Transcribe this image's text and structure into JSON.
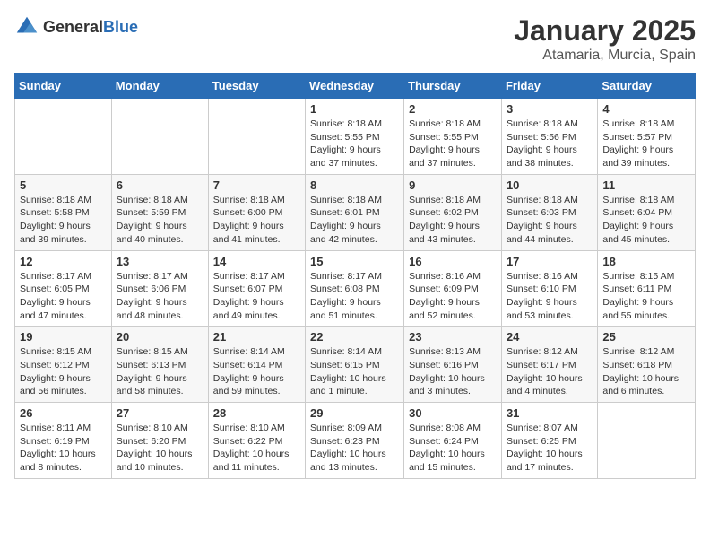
{
  "header": {
    "logo": {
      "general": "General",
      "blue": "Blue"
    },
    "title": "January 2025",
    "subtitle": "Atamaria, Murcia, Spain"
  },
  "days_of_week": [
    "Sunday",
    "Monday",
    "Tuesday",
    "Wednesday",
    "Thursday",
    "Friday",
    "Saturday"
  ],
  "weeks": [
    [
      {
        "day": "",
        "info": ""
      },
      {
        "day": "",
        "info": ""
      },
      {
        "day": "",
        "info": ""
      },
      {
        "day": "1",
        "info": "Sunrise: 8:18 AM\nSunset: 5:55 PM\nDaylight: 9 hours\nand 37 minutes."
      },
      {
        "day": "2",
        "info": "Sunrise: 8:18 AM\nSunset: 5:55 PM\nDaylight: 9 hours\nand 37 minutes."
      },
      {
        "day": "3",
        "info": "Sunrise: 8:18 AM\nSunset: 5:56 PM\nDaylight: 9 hours\nand 38 minutes."
      },
      {
        "day": "4",
        "info": "Sunrise: 8:18 AM\nSunset: 5:57 PM\nDaylight: 9 hours\nand 39 minutes."
      }
    ],
    [
      {
        "day": "5",
        "info": "Sunrise: 8:18 AM\nSunset: 5:58 PM\nDaylight: 9 hours\nand 39 minutes."
      },
      {
        "day": "6",
        "info": "Sunrise: 8:18 AM\nSunset: 5:59 PM\nDaylight: 9 hours\nand 40 minutes."
      },
      {
        "day": "7",
        "info": "Sunrise: 8:18 AM\nSunset: 6:00 PM\nDaylight: 9 hours\nand 41 minutes."
      },
      {
        "day": "8",
        "info": "Sunrise: 8:18 AM\nSunset: 6:01 PM\nDaylight: 9 hours\nand 42 minutes."
      },
      {
        "day": "9",
        "info": "Sunrise: 8:18 AM\nSunset: 6:02 PM\nDaylight: 9 hours\nand 43 minutes."
      },
      {
        "day": "10",
        "info": "Sunrise: 8:18 AM\nSunset: 6:03 PM\nDaylight: 9 hours\nand 44 minutes."
      },
      {
        "day": "11",
        "info": "Sunrise: 8:18 AM\nSunset: 6:04 PM\nDaylight: 9 hours\nand 45 minutes."
      }
    ],
    [
      {
        "day": "12",
        "info": "Sunrise: 8:17 AM\nSunset: 6:05 PM\nDaylight: 9 hours\nand 47 minutes."
      },
      {
        "day": "13",
        "info": "Sunrise: 8:17 AM\nSunset: 6:06 PM\nDaylight: 9 hours\nand 48 minutes."
      },
      {
        "day": "14",
        "info": "Sunrise: 8:17 AM\nSunset: 6:07 PM\nDaylight: 9 hours\nand 49 minutes."
      },
      {
        "day": "15",
        "info": "Sunrise: 8:17 AM\nSunset: 6:08 PM\nDaylight: 9 hours\nand 51 minutes."
      },
      {
        "day": "16",
        "info": "Sunrise: 8:16 AM\nSunset: 6:09 PM\nDaylight: 9 hours\nand 52 minutes."
      },
      {
        "day": "17",
        "info": "Sunrise: 8:16 AM\nSunset: 6:10 PM\nDaylight: 9 hours\nand 53 minutes."
      },
      {
        "day": "18",
        "info": "Sunrise: 8:15 AM\nSunset: 6:11 PM\nDaylight: 9 hours\nand 55 minutes."
      }
    ],
    [
      {
        "day": "19",
        "info": "Sunrise: 8:15 AM\nSunset: 6:12 PM\nDaylight: 9 hours\nand 56 minutes."
      },
      {
        "day": "20",
        "info": "Sunrise: 8:15 AM\nSunset: 6:13 PM\nDaylight: 9 hours\nand 58 minutes."
      },
      {
        "day": "21",
        "info": "Sunrise: 8:14 AM\nSunset: 6:14 PM\nDaylight: 9 hours\nand 59 minutes."
      },
      {
        "day": "22",
        "info": "Sunrise: 8:14 AM\nSunset: 6:15 PM\nDaylight: 10 hours\nand 1 minute."
      },
      {
        "day": "23",
        "info": "Sunrise: 8:13 AM\nSunset: 6:16 PM\nDaylight: 10 hours\nand 3 minutes."
      },
      {
        "day": "24",
        "info": "Sunrise: 8:12 AM\nSunset: 6:17 PM\nDaylight: 10 hours\nand 4 minutes."
      },
      {
        "day": "25",
        "info": "Sunrise: 8:12 AM\nSunset: 6:18 PM\nDaylight: 10 hours\nand 6 minutes."
      }
    ],
    [
      {
        "day": "26",
        "info": "Sunrise: 8:11 AM\nSunset: 6:19 PM\nDaylight: 10 hours\nand 8 minutes."
      },
      {
        "day": "27",
        "info": "Sunrise: 8:10 AM\nSunset: 6:20 PM\nDaylight: 10 hours\nand 10 minutes."
      },
      {
        "day": "28",
        "info": "Sunrise: 8:10 AM\nSunset: 6:22 PM\nDaylight: 10 hours\nand 11 minutes."
      },
      {
        "day": "29",
        "info": "Sunrise: 8:09 AM\nSunset: 6:23 PM\nDaylight: 10 hours\nand 13 minutes."
      },
      {
        "day": "30",
        "info": "Sunrise: 8:08 AM\nSunset: 6:24 PM\nDaylight: 10 hours\nand 15 minutes."
      },
      {
        "day": "31",
        "info": "Sunrise: 8:07 AM\nSunset: 6:25 PM\nDaylight: 10 hours\nand 17 minutes."
      },
      {
        "day": "",
        "info": ""
      }
    ]
  ]
}
